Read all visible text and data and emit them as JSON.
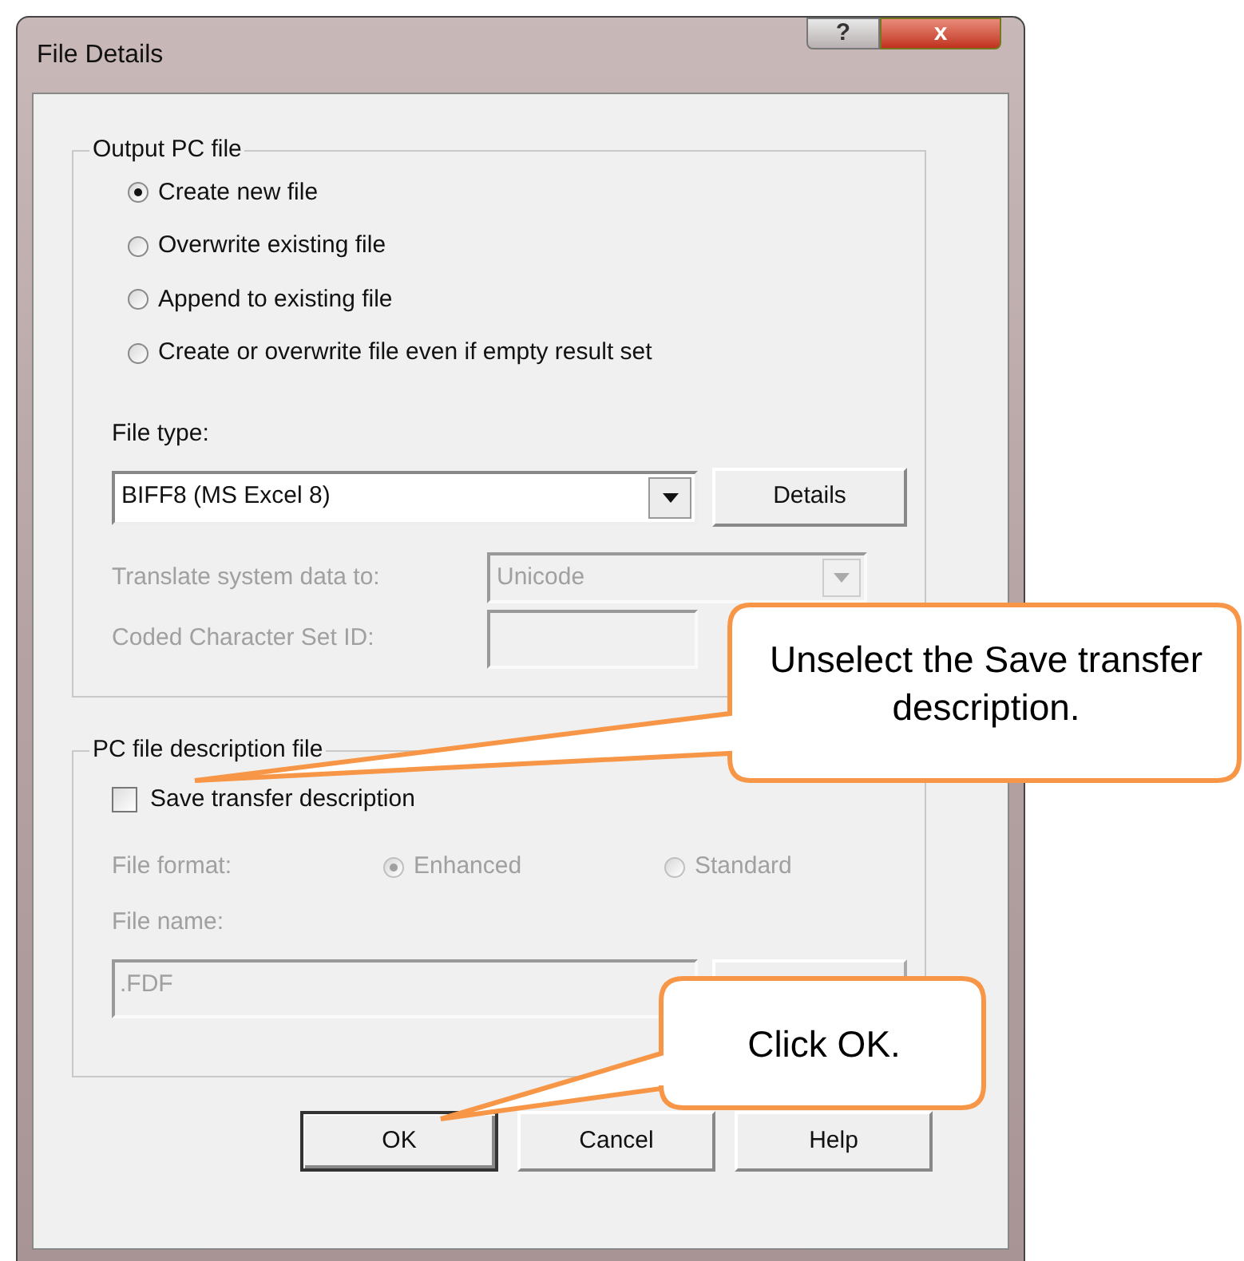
{
  "window": {
    "title": "File Details",
    "help_button": "?",
    "close_button": "x"
  },
  "output_group": {
    "legend": "Output PC file",
    "options": [
      {
        "label": "Create new file",
        "selected": true
      },
      {
        "label": "Overwrite existing file",
        "selected": false
      },
      {
        "label": "Append to existing file",
        "selected": false
      },
      {
        "label": "Create or overwrite file even if empty result set",
        "selected": false
      }
    ],
    "file_type": {
      "label": "File type:",
      "value": "BIFF8 (MS Excel 8)",
      "details_button": "Details"
    },
    "translate": {
      "label": "Translate system data to:",
      "value": "Unicode",
      "disabled": true
    },
    "ccsid": {
      "label": "Coded Character Set ID:",
      "disabled": true
    }
  },
  "description_group": {
    "legend": "PC file description file",
    "save_description": {
      "label": "Save transfer description",
      "checked": false
    },
    "file_format": {
      "label": "File format:",
      "disabled": true,
      "options": [
        {
          "label": "Enhanced",
          "selected": true
        },
        {
          "label": "Standard",
          "selected": false
        }
      ]
    },
    "file_name": {
      "label": "File name:",
      "value": ".FDF",
      "disabled": true
    }
  },
  "buttons": [
    {
      "label": "OK",
      "default": true
    },
    {
      "label": "Cancel",
      "default": false
    },
    {
      "label": "Help",
      "default": false
    }
  ],
  "callouts": [
    {
      "text": "Unselect the Save transfer description."
    },
    {
      "text": "Click OK."
    }
  ]
}
